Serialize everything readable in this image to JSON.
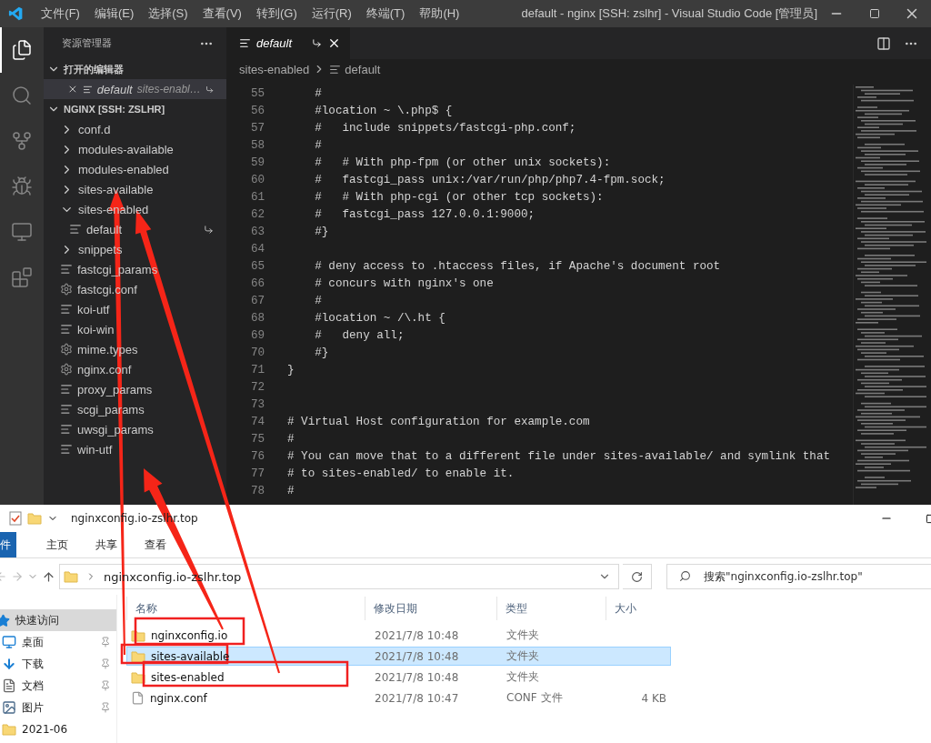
{
  "titlebar": {
    "menu": [
      "文件(F)",
      "编辑(E)",
      "选择(S)",
      "查看(V)",
      "转到(G)",
      "运行(R)",
      "终端(T)",
      "帮助(H)"
    ],
    "title": "default - nginx [SSH: zslhr] - Visual Studio Code [管理员]"
  },
  "activity_bar": [
    {
      "kind": "files",
      "selected": true
    },
    {
      "kind": "search",
      "selected": false
    },
    {
      "kind": "source_control",
      "selected": false
    },
    {
      "kind": "debug",
      "selected": false
    },
    {
      "kind": "remote",
      "selected": false
    },
    {
      "kind": "extensions",
      "selected": false
    }
  ],
  "sidebar": {
    "title": "资源管理器",
    "open_editors": {
      "title": "打开的编辑器",
      "expanded": true,
      "items": [
        {
          "name": "default",
          "description": "sites-enabl…",
          "symlink": true,
          "selected": true
        }
      ]
    },
    "folder": {
      "title": "NGINX [SSH: ZSLHR]",
      "expanded": true,
      "tree": [
        {
          "name": "conf.d",
          "kind": "folder",
          "expanded": false
        },
        {
          "name": "modules-available",
          "kind": "folder",
          "expanded": false
        },
        {
          "name": "modules-enabled",
          "kind": "folder",
          "expanded": false
        },
        {
          "name": "sites-available",
          "kind": "folder",
          "expanded": false
        },
        {
          "name": "sites-enabled",
          "kind": "folder",
          "expanded": true,
          "children": [
            {
              "name": "default",
              "kind": "text",
              "symlink": true
            }
          ]
        },
        {
          "name": "snippets",
          "kind": "folder",
          "expanded": false
        },
        {
          "name": "fastcgi_params",
          "kind": "text"
        },
        {
          "name": "fastcgi.conf",
          "kind": "settings"
        },
        {
          "name": "koi-utf",
          "kind": "text"
        },
        {
          "name": "koi-win",
          "kind": "text"
        },
        {
          "name": "mime.types",
          "kind": "settings"
        },
        {
          "name": "nginx.conf",
          "kind": "settings"
        },
        {
          "name": "proxy_params",
          "kind": "text"
        },
        {
          "name": "scgi_params",
          "kind": "text"
        },
        {
          "name": "uwsgi_params",
          "kind": "text"
        },
        {
          "name": "win-utf",
          "kind": "text"
        }
      ]
    }
  },
  "editor": {
    "tabs": [
      {
        "name": "default",
        "selected": true,
        "preview": true,
        "symlink": true
      }
    ],
    "breadcrumbs": [
      "sites-enabled",
      "default"
    ],
    "lines": [
      {
        "number": "55",
        "text": "    #"
      },
      {
        "number": "56",
        "text": "    #location ~ \\.php$ {"
      },
      {
        "number": "57",
        "text": "    #   include snippets/fastcgi-php.conf;"
      },
      {
        "number": "58",
        "text": "    #"
      },
      {
        "number": "59",
        "text": "    #   # With php-fpm (or other unix sockets):"
      },
      {
        "number": "60",
        "text": "    #   fastcgi_pass unix:/var/run/php/php7.4-fpm.sock;"
      },
      {
        "number": "61",
        "text": "    #   # With php-cgi (or other tcp sockets):"
      },
      {
        "number": "62",
        "text": "    #   fastcgi_pass 127.0.0.1:9000;"
      },
      {
        "number": "63",
        "text": "    #}"
      },
      {
        "number": "64"
      },
      {
        "number": "65",
        "text": "    # deny access to .htaccess files, if Apache's document root"
      },
      {
        "number": "66",
        "text": "    # concurs with nginx's one"
      },
      {
        "number": "67",
        "text": "    #"
      },
      {
        "number": "68",
        "text": "    #location ~ /\\.ht {"
      },
      {
        "number": "69",
        "text": "    #   deny all;"
      },
      {
        "number": "70",
        "text": "    #}"
      },
      {
        "number": "71",
        "text": "}"
      },
      {
        "number": "72"
      },
      {
        "number": "73"
      },
      {
        "number": "74",
        "text": "# Virtual Host configuration for example.com"
      },
      {
        "number": "75",
        "text": "#"
      },
      {
        "number": "76",
        "text": "# You can move that to a different file under sites-available/ and symlink that"
      },
      {
        "number": "77",
        "text": "# to sites-enabled/ to enable it."
      },
      {
        "number": "78",
        "text": "#"
      }
    ]
  },
  "explorer": {
    "title": "nginxconfig.io-zslhr.top",
    "ribbon_tabs": [
      {
        "label": "件",
        "kind": "file_menu"
      },
      {
        "label": "主页",
        "kind": "tab"
      },
      {
        "label": "共享",
        "kind": "tab"
      },
      {
        "label": "查看",
        "kind": "tab"
      }
    ],
    "address": "nginxconfig.io-zslhr.top",
    "search": {
      "placeholder": "搜索\"nginxconfig.io-zslhr.top\""
    },
    "nav": [
      {
        "label": "快速访问",
        "kind": "star",
        "selected": true,
        "pinned": false
      },
      {
        "label": "桌面",
        "kind": "desktop",
        "selected": false,
        "pinned": true
      },
      {
        "label": "下载",
        "kind": "download",
        "selected": false,
        "pinned": true
      },
      {
        "label": "文档",
        "kind": "document",
        "selected": false,
        "pinned": true
      },
      {
        "label": "图片",
        "kind": "picture",
        "selected": false,
        "pinned": true
      },
      {
        "label": "2021-06",
        "kind": "folder",
        "selected": false,
        "pinned": false
      }
    ],
    "columns": [
      "名称",
      "修改日期",
      "类型",
      "大小"
    ],
    "files": [
      {
        "name": "nginxconfig.io",
        "kind": "folder",
        "date": "2021/7/8 10:48",
        "type": "文件夹",
        "selected": false
      },
      {
        "name": "sites-available",
        "kind": "folder",
        "date": "2021/7/8 10:48",
        "type": "文件夹",
        "selected": true
      },
      {
        "name": "sites-enabled",
        "kind": "folder",
        "date": "2021/7/8 10:48",
        "type": "文件夹",
        "selected": false
      },
      {
        "name": "nginx.conf",
        "kind": "file",
        "date": "2021/7/8 10:47",
        "type": "CONF 文件",
        "size": "4 KB",
        "selected": false
      }
    ]
  }
}
